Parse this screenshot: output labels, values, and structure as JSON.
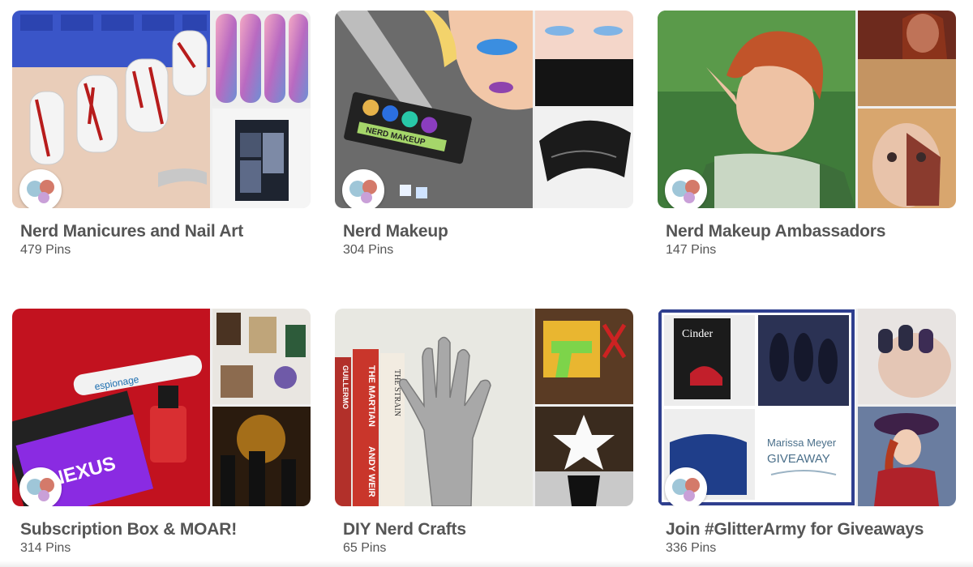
{
  "boards": [
    {
      "title": "Nerd Manicures and Nail Art",
      "pins": "479 Pins"
    },
    {
      "title": "Nerd Makeup",
      "pins": "304 Pins"
    },
    {
      "title": "Nerd Makeup Ambassadors",
      "pins": "147 Pins"
    },
    {
      "title": "Subscription Box & MOAR!",
      "pins": "314 Pins"
    },
    {
      "title": "DIY Nerd Crafts",
      "pins": "65 Pins"
    },
    {
      "title": "Join #GlitterArmy for Giveaways",
      "pins": "336 Pins"
    }
  ],
  "image_text": {
    "nerd_makeup_palette": "NERD MAKEUP",
    "nexus_box": "NEXUS",
    "espionage": "espionage",
    "cinder_book": "Cinder",
    "book_martian": "THE MARTIAN",
    "book_author": "ANDY WEIR",
    "book_strain": "THE STRAIN",
    "book_guillermo": "GUILLERMO",
    "giveaway_name": "Marissa Meyer",
    "giveaway_word": "GIVEAWAY"
  },
  "colors": {
    "title_text": "#555555",
    "count_text": "#555555",
    "giveaway_border": "#2f3f8f"
  }
}
